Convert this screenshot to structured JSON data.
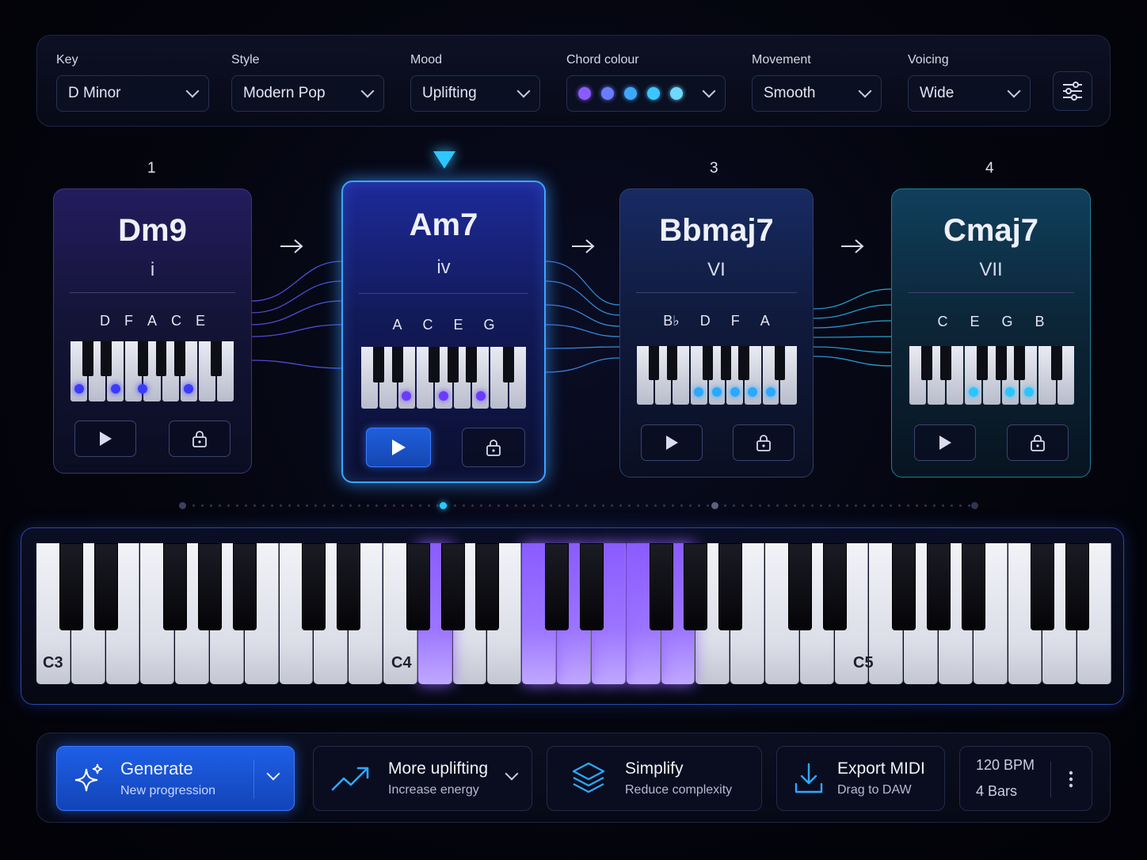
{
  "controls": {
    "key": {
      "label": "Key",
      "value": "D Minor"
    },
    "style": {
      "label": "Style",
      "value": "Modern Pop"
    },
    "mood": {
      "label": "Mood",
      "value": "Uplifting"
    },
    "chord_colour": {
      "label": "Chord colour",
      "colors": [
        "#8a5cff",
        "#6b7cff",
        "#3ea8ff",
        "#3cc6ff",
        "#6fd8ff"
      ]
    },
    "movement": {
      "label": "Movement",
      "value": "Smooth"
    },
    "voicing": {
      "label": "Voicing",
      "value": "Wide"
    },
    "settings_icon": "sliders-icon"
  },
  "progression": [
    {
      "position": "1",
      "name": "Dm9",
      "roman": "i",
      "notes": [
        "D",
        "F",
        "A",
        "C",
        "E"
      ],
      "accent": "#3b3bff"
    },
    {
      "position": "",
      "name": "Am7",
      "roman": "iv",
      "notes": [
        "A",
        "C",
        "E",
        "G"
      ],
      "accent": "#6a3bff",
      "active": true
    },
    {
      "position": "3",
      "name": "Bbmaj7",
      "roman": "VI",
      "notes": [
        "B♭",
        "D",
        "F",
        "A"
      ],
      "accent": "#2ba8ff"
    },
    {
      "position": "4",
      "name": "Cmaj7",
      "roman": "VII",
      "notes": [
        "C",
        "E",
        "G",
        "B"
      ],
      "accent": "#2cc4ff"
    }
  ],
  "keyboard": {
    "octave_labels": [
      "C3",
      "C4",
      "C5"
    ],
    "highlight_color": "#8a5cff"
  },
  "actions": {
    "generate": {
      "title": "Generate",
      "subtitle": "New progression",
      "icon": "sparkle-icon"
    },
    "uplift": {
      "title": "More uplifting",
      "subtitle": "Increase energy",
      "icon": "trend-up-icon"
    },
    "simplify": {
      "title": "Simplify",
      "subtitle": "Reduce complexity",
      "icon": "layers-icon"
    },
    "export": {
      "title": "Export MIDI",
      "subtitle": "Drag to DAW",
      "icon": "download-icon"
    },
    "tempo": {
      "bpm": "120 BPM",
      "bars": "4 Bars"
    }
  },
  "colors": {
    "accent_blue": "#2f7bff",
    "accent_cyan": "#2fc7ff",
    "accent_purple": "#8a5cff"
  }
}
